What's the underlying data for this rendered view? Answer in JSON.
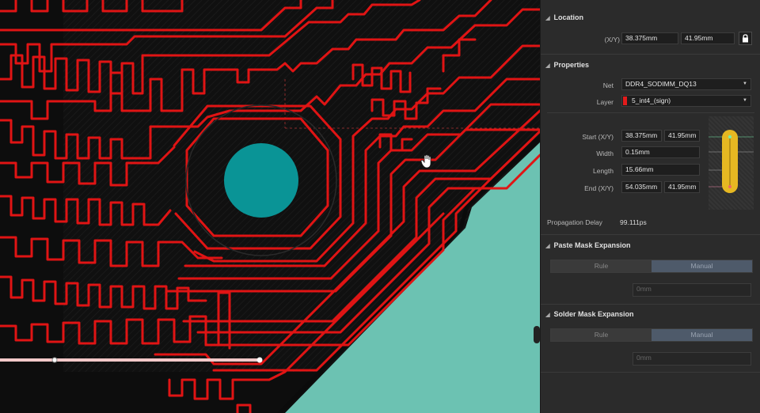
{
  "location": {
    "header": "Location",
    "xy_label": "(X/Y)",
    "x": "38.375mm",
    "y": "41.95mm"
  },
  "properties": {
    "header": "Properties",
    "net_label": "Net",
    "net_value": "DDR4_SODIMM_DQ13",
    "layer_label": "Layer",
    "layer_value": "5_int4_(sign)",
    "layer_color": "#e21b1b",
    "start_label": "Start (X/Y)",
    "start_x": "38.375mm",
    "start_y": "41.95mm",
    "width_label": "Width",
    "width_value": "0.15mm",
    "length_label": "Length",
    "length_value": "15.66mm",
    "end_label": "End (X/Y)",
    "end_x": "54.035mm",
    "end_y": "41.95mm",
    "prop_delay_label": "Propagation Delay",
    "prop_delay_value": "99.111ps"
  },
  "paste_mask": {
    "header": "Paste Mask Expansion",
    "rule": "Rule",
    "manual": "Manual",
    "value": "0mm"
  },
  "solder_mask": {
    "header": "Solder Mask Expansion",
    "rule": "Rule",
    "manual": "Manual",
    "value": "0mm"
  },
  "colors": {
    "trace": "#e01414",
    "pad": "#0a9496",
    "copper_plane": "#6cc2b2",
    "board_bg": "#0d0d0d"
  },
  "icons": [
    "lock-icon",
    "hand-cursor-icon",
    "collapse-triangle-icon",
    "dropdown-arrow-icon"
  ]
}
